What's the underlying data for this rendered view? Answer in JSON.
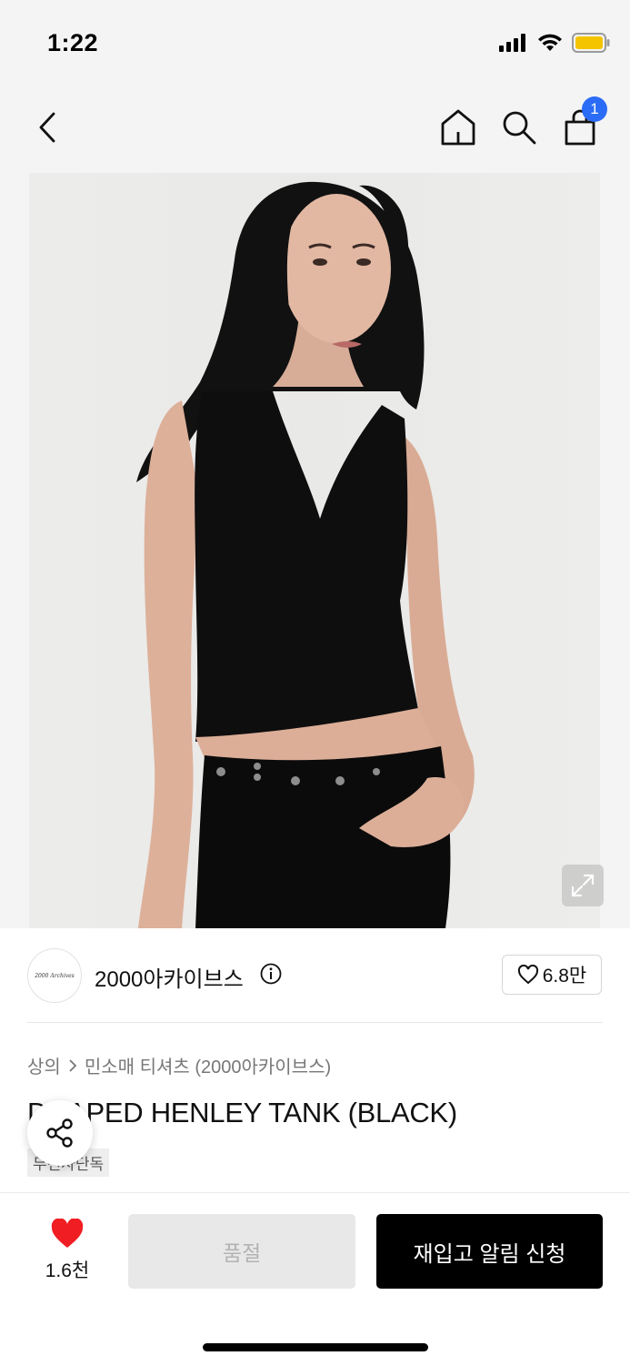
{
  "status_bar": {
    "time": "1:22",
    "signal_icon": "cellular-signal-icon",
    "wifi_icon": "wifi-icon",
    "battery_icon": "battery-icon",
    "battery_color": "#f5c400"
  },
  "nav": {
    "back_icon": "chevron-left-icon",
    "home_icon": "home-icon",
    "search_icon": "search-icon",
    "cart_icon": "shopping-bag-icon",
    "cart_count": "1",
    "badge_color": "#2b6cf6"
  },
  "hero": {
    "expand_icon": "expand-icon"
  },
  "brand": {
    "logo_text": "2000 Archives",
    "name": "2000아카이브스",
    "info_icon": "info-icon",
    "likes": "6.8만"
  },
  "product": {
    "breadcrumb": [
      "상의",
      "민소매 티셔츠 (2000아카이브스)"
    ],
    "title": "DRAPED HENLEY TANK (BLACK)",
    "tag": "무신사단독",
    "share_icon": "share-icon"
  },
  "bottom_bar": {
    "wish_icon": "heart-filled-icon",
    "wish_count": "1.6천",
    "soldout_label": "품절",
    "restock_label": "재입고 알림 신청",
    "heart_color": "#f01e23"
  }
}
